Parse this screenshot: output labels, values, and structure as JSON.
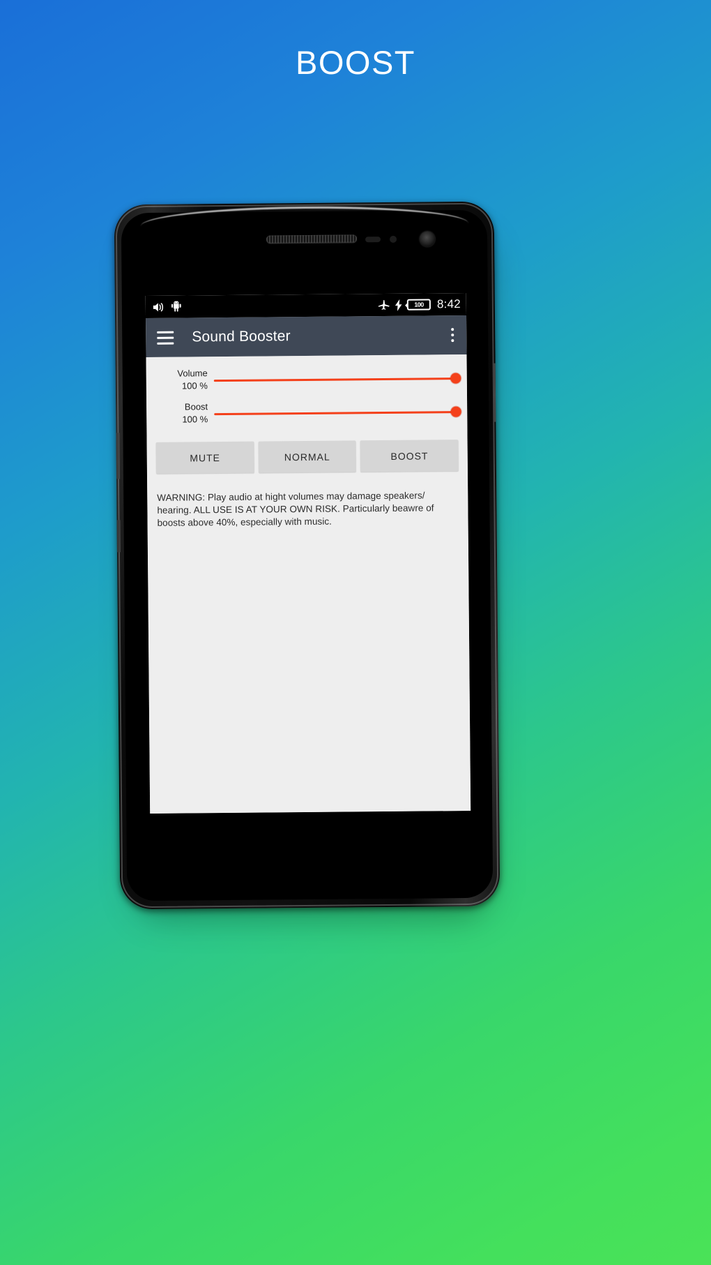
{
  "page": {
    "title": "BOOST",
    "background_start": "#1a6fd8",
    "background_end": "#4ae257"
  },
  "device": {
    "statusbar": {
      "left_icons": [
        "speaker-icon",
        "android-robot-icon"
      ],
      "right_icons": [
        "airplane-mode-icon",
        "charging-bolt-icon"
      ],
      "battery_level": "100",
      "time": "8:42",
      "background": "#000000"
    },
    "appbar": {
      "menu_icon": "hamburger-menu-icon",
      "title": "Sound Booster",
      "overflow_icon": "more-vertical-icon",
      "background": "#3f4856"
    },
    "content": {
      "accent_color": "#f4401a",
      "sliders": [
        {
          "name": "Volume",
          "value": "100 %",
          "percent": 100
        },
        {
          "name": "Boost",
          "value": "100 %",
          "percent": 100
        }
      ],
      "buttons": [
        {
          "label": "MUTE"
        },
        {
          "label": "NORMAL"
        },
        {
          "label": "BOOST"
        }
      ],
      "warning": "WARNING: Play audio at hight volumes may damage speakers/ hearing. ALL USE IS AT YOUR OWN RISK. Particularly beawre of boosts above 40%, especially with music."
    }
  }
}
